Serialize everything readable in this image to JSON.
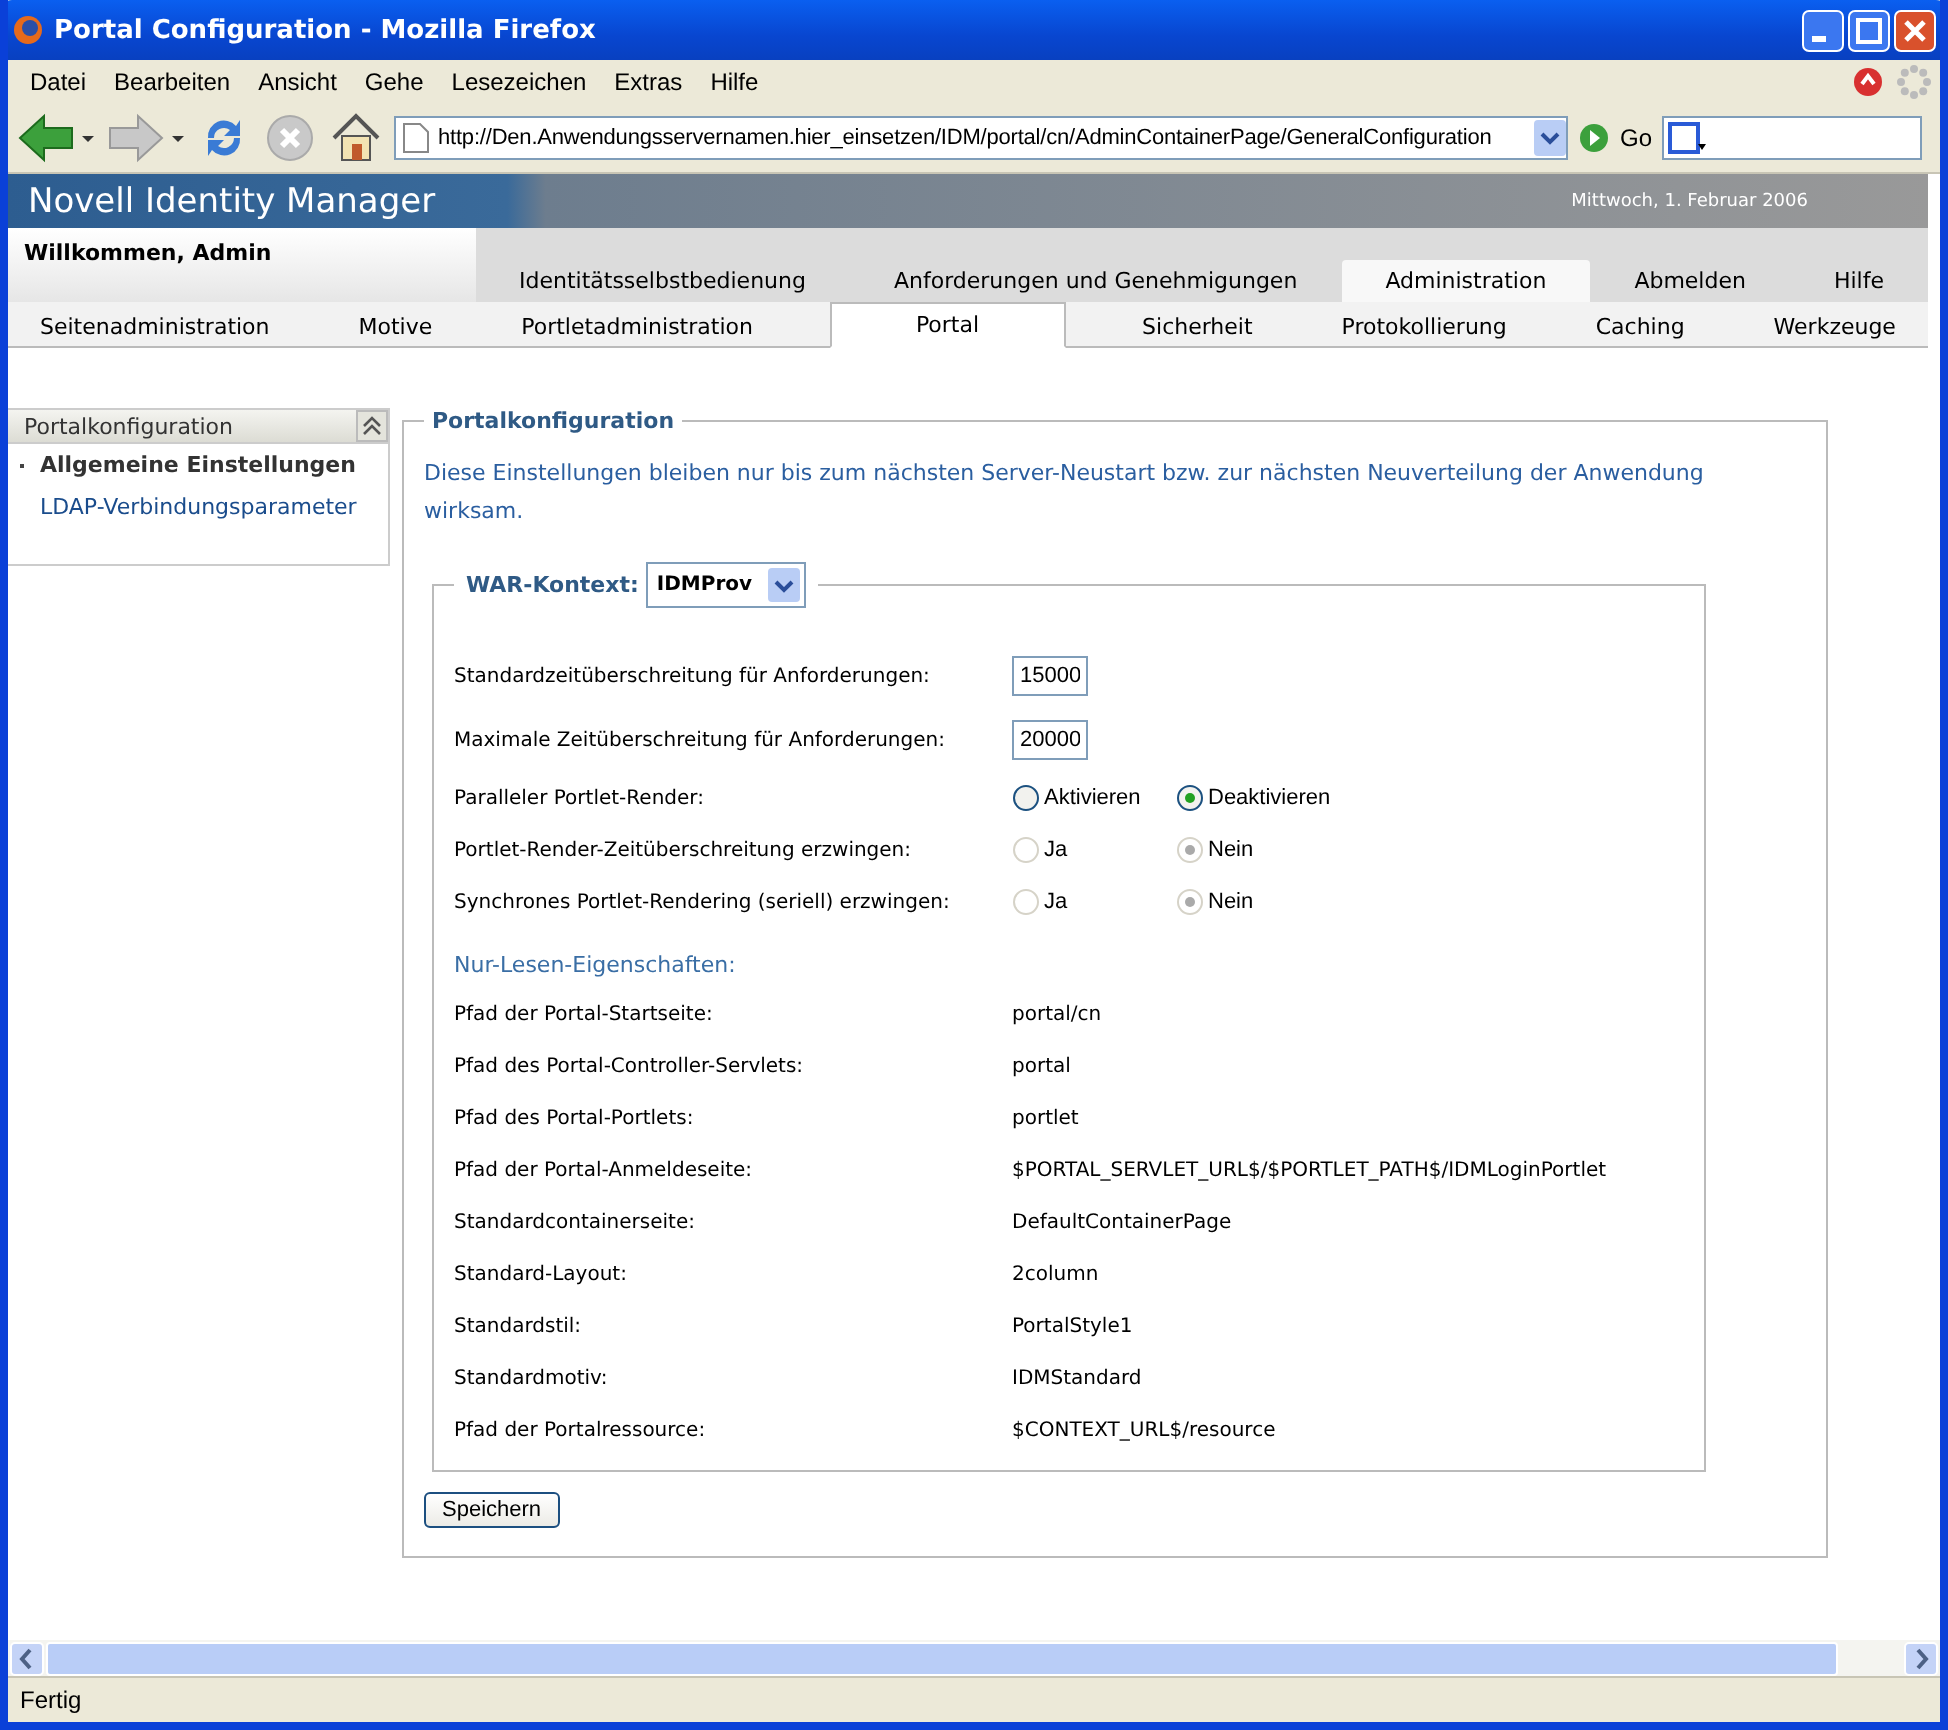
{
  "window": {
    "title": "Portal Configuration - Mozilla Firefox"
  },
  "menu": [
    "Datei",
    "Bearbeiten",
    "Ansicht",
    "Gehe",
    "Lesezeichen",
    "Extras",
    "Hilfe"
  ],
  "toolbar": {
    "url": "http://Den.Anwendungsservernamen.hier_einsetzen/IDM/portal/cn/AdminContainerPage/GeneralConfiguration",
    "go": "Go"
  },
  "app": {
    "brand": "Novell",
    "product": "Identity Manager",
    "date": "Mittwoch, 1. Februar 2006",
    "welcome": "Willkommen, Admin"
  },
  "top_tabs": [
    {
      "label": "Identitätsselbstbedienung",
      "selected": false
    },
    {
      "label": "Anforderungen und Genehmigungen",
      "selected": false
    },
    {
      "label": "Administration",
      "selected": true
    },
    {
      "label": "Abmelden",
      "selected": false
    },
    {
      "label": "Hilfe",
      "selected": false
    }
  ],
  "sub_tabs": [
    {
      "label": "Seitenadministration",
      "selected": false
    },
    {
      "label": "Motive",
      "selected": false
    },
    {
      "label": "Portletadministration",
      "selected": false
    },
    {
      "label": "Portal",
      "selected": true
    },
    {
      "label": "Sicherheit",
      "selected": false
    },
    {
      "label": "Protokollierung",
      "selected": false
    },
    {
      "label": "Caching",
      "selected": false
    },
    {
      "label": "Werkzeuge",
      "selected": false
    }
  ],
  "sidebar": {
    "title": "Portalkonfiguration",
    "items": [
      {
        "label": "Allgemeine Einstellungen",
        "selected": true
      },
      {
        "label": "LDAP-Verbindungsparameter",
        "selected": false
      }
    ]
  },
  "panel": {
    "title": "Portalkonfiguration",
    "notice": "Diese Einstellungen bleiben nur bis zum nächsten Server-Neustart bzw. zur nächsten Neuverteilung der Anwendung wirksam.",
    "context_label": "WAR-Kontext:",
    "context_value": "IDMProv",
    "fields": [
      {
        "kind": "text",
        "label": "Standardzeitüberschreitung für Anforderungen:",
        "value": "15000"
      },
      {
        "kind": "text",
        "label": "Maximale Zeitüberschreitung für Anforderungen:",
        "value": "20000"
      },
      {
        "kind": "radio",
        "label": "Paralleler Portlet-Render:",
        "disabled": false,
        "options": [
          {
            "label": "Aktivieren",
            "selected": false
          },
          {
            "label": "Deaktivieren",
            "selected": true
          }
        ]
      },
      {
        "kind": "radio",
        "label": "Portlet-Render-Zeitüberschreitung erzwingen:",
        "disabled": true,
        "options": [
          {
            "label": "Ja",
            "selected": false
          },
          {
            "label": "Nein",
            "selected": true
          }
        ]
      },
      {
        "kind": "radio",
        "label": "Synchrones Portlet-Rendering (seriell) erzwingen:",
        "disabled": true,
        "options": [
          {
            "label": "Ja",
            "selected": false
          },
          {
            "label": "Nein",
            "selected": true
          }
        ]
      }
    ],
    "readonly_title": "Nur-Lesen-Eigenschaften:",
    "readonly": [
      {
        "label": "Pfad der Portal-Startseite:",
        "value": "portal/cn"
      },
      {
        "label": "Pfad des Portal-Controller-Servlets:",
        "value": "portal"
      },
      {
        "label": "Pfad des Portal-Portlets:",
        "value": "portlet"
      },
      {
        "label": "Pfad der Portal-Anmeldeseite:",
        "value": "$PORTAL_SERVLET_URL$/$PORTLET_PATH$/IDMLoginPortlet"
      },
      {
        "label": "Standardcontainerseite:",
        "value": "DefaultContainerPage"
      },
      {
        "label": "Standard-Layout:",
        "value": "2column"
      },
      {
        "label": "Standardstil:",
        "value": "PortalStyle1"
      },
      {
        "label": "Standardmotiv:",
        "value": "IDMStandard"
      },
      {
        "label": "Pfad der Portalressource:",
        "value": "$CONTEXT_URL$/resource"
      }
    ],
    "save": "Speichern"
  },
  "status_bar": "Fertig"
}
